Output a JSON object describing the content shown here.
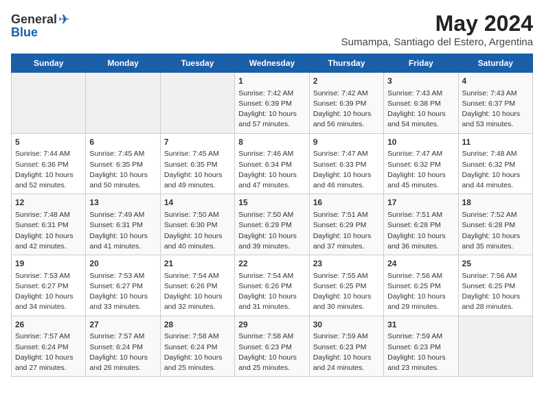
{
  "logo": {
    "text_general": "General",
    "text_blue": "Blue"
  },
  "title": "May 2024",
  "subtitle": "Sumampa, Santiago del Estero, Argentina",
  "days_of_week": [
    "Sunday",
    "Monday",
    "Tuesday",
    "Wednesday",
    "Thursday",
    "Friday",
    "Saturday"
  ],
  "weeks": [
    [
      {
        "day": "",
        "sunrise": "",
        "sunset": "",
        "daylight": ""
      },
      {
        "day": "",
        "sunrise": "",
        "sunset": "",
        "daylight": ""
      },
      {
        "day": "",
        "sunrise": "",
        "sunset": "",
        "daylight": ""
      },
      {
        "day": "1",
        "sunrise": "Sunrise: 7:42 AM",
        "sunset": "Sunset: 6:39 PM",
        "daylight": "Daylight: 10 hours and 57 minutes."
      },
      {
        "day": "2",
        "sunrise": "Sunrise: 7:42 AM",
        "sunset": "Sunset: 6:39 PM",
        "daylight": "Daylight: 10 hours and 56 minutes."
      },
      {
        "day": "3",
        "sunrise": "Sunrise: 7:43 AM",
        "sunset": "Sunset: 6:38 PM",
        "daylight": "Daylight: 10 hours and 54 minutes."
      },
      {
        "day": "4",
        "sunrise": "Sunrise: 7:43 AM",
        "sunset": "Sunset: 6:37 PM",
        "daylight": "Daylight: 10 hours and 53 minutes."
      }
    ],
    [
      {
        "day": "5",
        "sunrise": "Sunrise: 7:44 AM",
        "sunset": "Sunset: 6:36 PM",
        "daylight": "Daylight: 10 hours and 52 minutes."
      },
      {
        "day": "6",
        "sunrise": "Sunrise: 7:45 AM",
        "sunset": "Sunset: 6:35 PM",
        "daylight": "Daylight: 10 hours and 50 minutes."
      },
      {
        "day": "7",
        "sunrise": "Sunrise: 7:45 AM",
        "sunset": "Sunset: 6:35 PM",
        "daylight": "Daylight: 10 hours and 49 minutes."
      },
      {
        "day": "8",
        "sunrise": "Sunrise: 7:46 AM",
        "sunset": "Sunset: 6:34 PM",
        "daylight": "Daylight: 10 hours and 47 minutes."
      },
      {
        "day": "9",
        "sunrise": "Sunrise: 7:47 AM",
        "sunset": "Sunset: 6:33 PM",
        "daylight": "Daylight: 10 hours and 46 minutes."
      },
      {
        "day": "10",
        "sunrise": "Sunrise: 7:47 AM",
        "sunset": "Sunset: 6:32 PM",
        "daylight": "Daylight: 10 hours and 45 minutes."
      },
      {
        "day": "11",
        "sunrise": "Sunrise: 7:48 AM",
        "sunset": "Sunset: 6:32 PM",
        "daylight": "Daylight: 10 hours and 44 minutes."
      }
    ],
    [
      {
        "day": "12",
        "sunrise": "Sunrise: 7:48 AM",
        "sunset": "Sunset: 6:31 PM",
        "daylight": "Daylight: 10 hours and 42 minutes."
      },
      {
        "day": "13",
        "sunrise": "Sunrise: 7:49 AM",
        "sunset": "Sunset: 6:31 PM",
        "daylight": "Daylight: 10 hours and 41 minutes."
      },
      {
        "day": "14",
        "sunrise": "Sunrise: 7:50 AM",
        "sunset": "Sunset: 6:30 PM",
        "daylight": "Daylight: 10 hours and 40 minutes."
      },
      {
        "day": "15",
        "sunrise": "Sunrise: 7:50 AM",
        "sunset": "Sunset: 6:29 PM",
        "daylight": "Daylight: 10 hours and 39 minutes."
      },
      {
        "day": "16",
        "sunrise": "Sunrise: 7:51 AM",
        "sunset": "Sunset: 6:29 PM",
        "daylight": "Daylight: 10 hours and 37 minutes."
      },
      {
        "day": "17",
        "sunrise": "Sunrise: 7:51 AM",
        "sunset": "Sunset: 6:28 PM",
        "daylight": "Daylight: 10 hours and 36 minutes."
      },
      {
        "day": "18",
        "sunrise": "Sunrise: 7:52 AM",
        "sunset": "Sunset: 6:28 PM",
        "daylight": "Daylight: 10 hours and 35 minutes."
      }
    ],
    [
      {
        "day": "19",
        "sunrise": "Sunrise: 7:53 AM",
        "sunset": "Sunset: 6:27 PM",
        "daylight": "Daylight: 10 hours and 34 minutes."
      },
      {
        "day": "20",
        "sunrise": "Sunrise: 7:53 AM",
        "sunset": "Sunset: 6:27 PM",
        "daylight": "Daylight: 10 hours and 33 minutes."
      },
      {
        "day": "21",
        "sunrise": "Sunrise: 7:54 AM",
        "sunset": "Sunset: 6:26 PM",
        "daylight": "Daylight: 10 hours and 32 minutes."
      },
      {
        "day": "22",
        "sunrise": "Sunrise: 7:54 AM",
        "sunset": "Sunset: 6:26 PM",
        "daylight": "Daylight: 10 hours and 31 minutes."
      },
      {
        "day": "23",
        "sunrise": "Sunrise: 7:55 AM",
        "sunset": "Sunset: 6:25 PM",
        "daylight": "Daylight: 10 hours and 30 minutes."
      },
      {
        "day": "24",
        "sunrise": "Sunrise: 7:56 AM",
        "sunset": "Sunset: 6:25 PM",
        "daylight": "Daylight: 10 hours and 29 minutes."
      },
      {
        "day": "25",
        "sunrise": "Sunrise: 7:56 AM",
        "sunset": "Sunset: 6:25 PM",
        "daylight": "Daylight: 10 hours and 28 minutes."
      }
    ],
    [
      {
        "day": "26",
        "sunrise": "Sunrise: 7:57 AM",
        "sunset": "Sunset: 6:24 PM",
        "daylight": "Daylight: 10 hours and 27 minutes."
      },
      {
        "day": "27",
        "sunrise": "Sunrise: 7:57 AM",
        "sunset": "Sunset: 6:24 PM",
        "daylight": "Daylight: 10 hours and 26 minutes."
      },
      {
        "day": "28",
        "sunrise": "Sunrise: 7:58 AM",
        "sunset": "Sunset: 6:24 PM",
        "daylight": "Daylight: 10 hours and 25 minutes."
      },
      {
        "day": "29",
        "sunrise": "Sunrise: 7:58 AM",
        "sunset": "Sunset: 6:23 PM",
        "daylight": "Daylight: 10 hours and 25 minutes."
      },
      {
        "day": "30",
        "sunrise": "Sunrise: 7:59 AM",
        "sunset": "Sunset: 6:23 PM",
        "daylight": "Daylight: 10 hours and 24 minutes."
      },
      {
        "day": "31",
        "sunrise": "Sunrise: 7:59 AM",
        "sunset": "Sunset: 6:23 PM",
        "daylight": "Daylight: 10 hours and 23 minutes."
      },
      {
        "day": "",
        "sunrise": "",
        "sunset": "",
        "daylight": ""
      }
    ]
  ]
}
